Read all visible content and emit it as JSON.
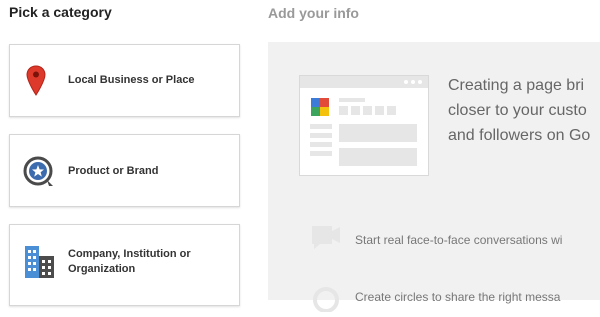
{
  "left_heading": "Pick a category",
  "right_heading": "Add your info",
  "categories": [
    {
      "label": "Local Business or Place",
      "icon": "map-pin-icon"
    },
    {
      "label": "Product or Brand",
      "icon": "brand-badge-icon"
    },
    {
      "label_line1": "Company, Institution or",
      "label_line2": "Organization",
      "icon": "buildings-icon"
    }
  ],
  "info_panel": {
    "text_lines": [
      "Creating a page bri",
      "closer to your custo",
      "and followers on Go"
    ],
    "features": [
      {
        "text": "Start real face-to-face conversations wi",
        "icon": "video-camera-icon"
      },
      {
        "text": "Create circles to share the right messa",
        "icon": "circles-icon"
      }
    ]
  },
  "colors": {
    "pin_red": "#dd3a2c",
    "badge_blue": "#3d6cae",
    "building_blue": "#4a8fd6",
    "building_dark": "#4c4c4c"
  }
}
